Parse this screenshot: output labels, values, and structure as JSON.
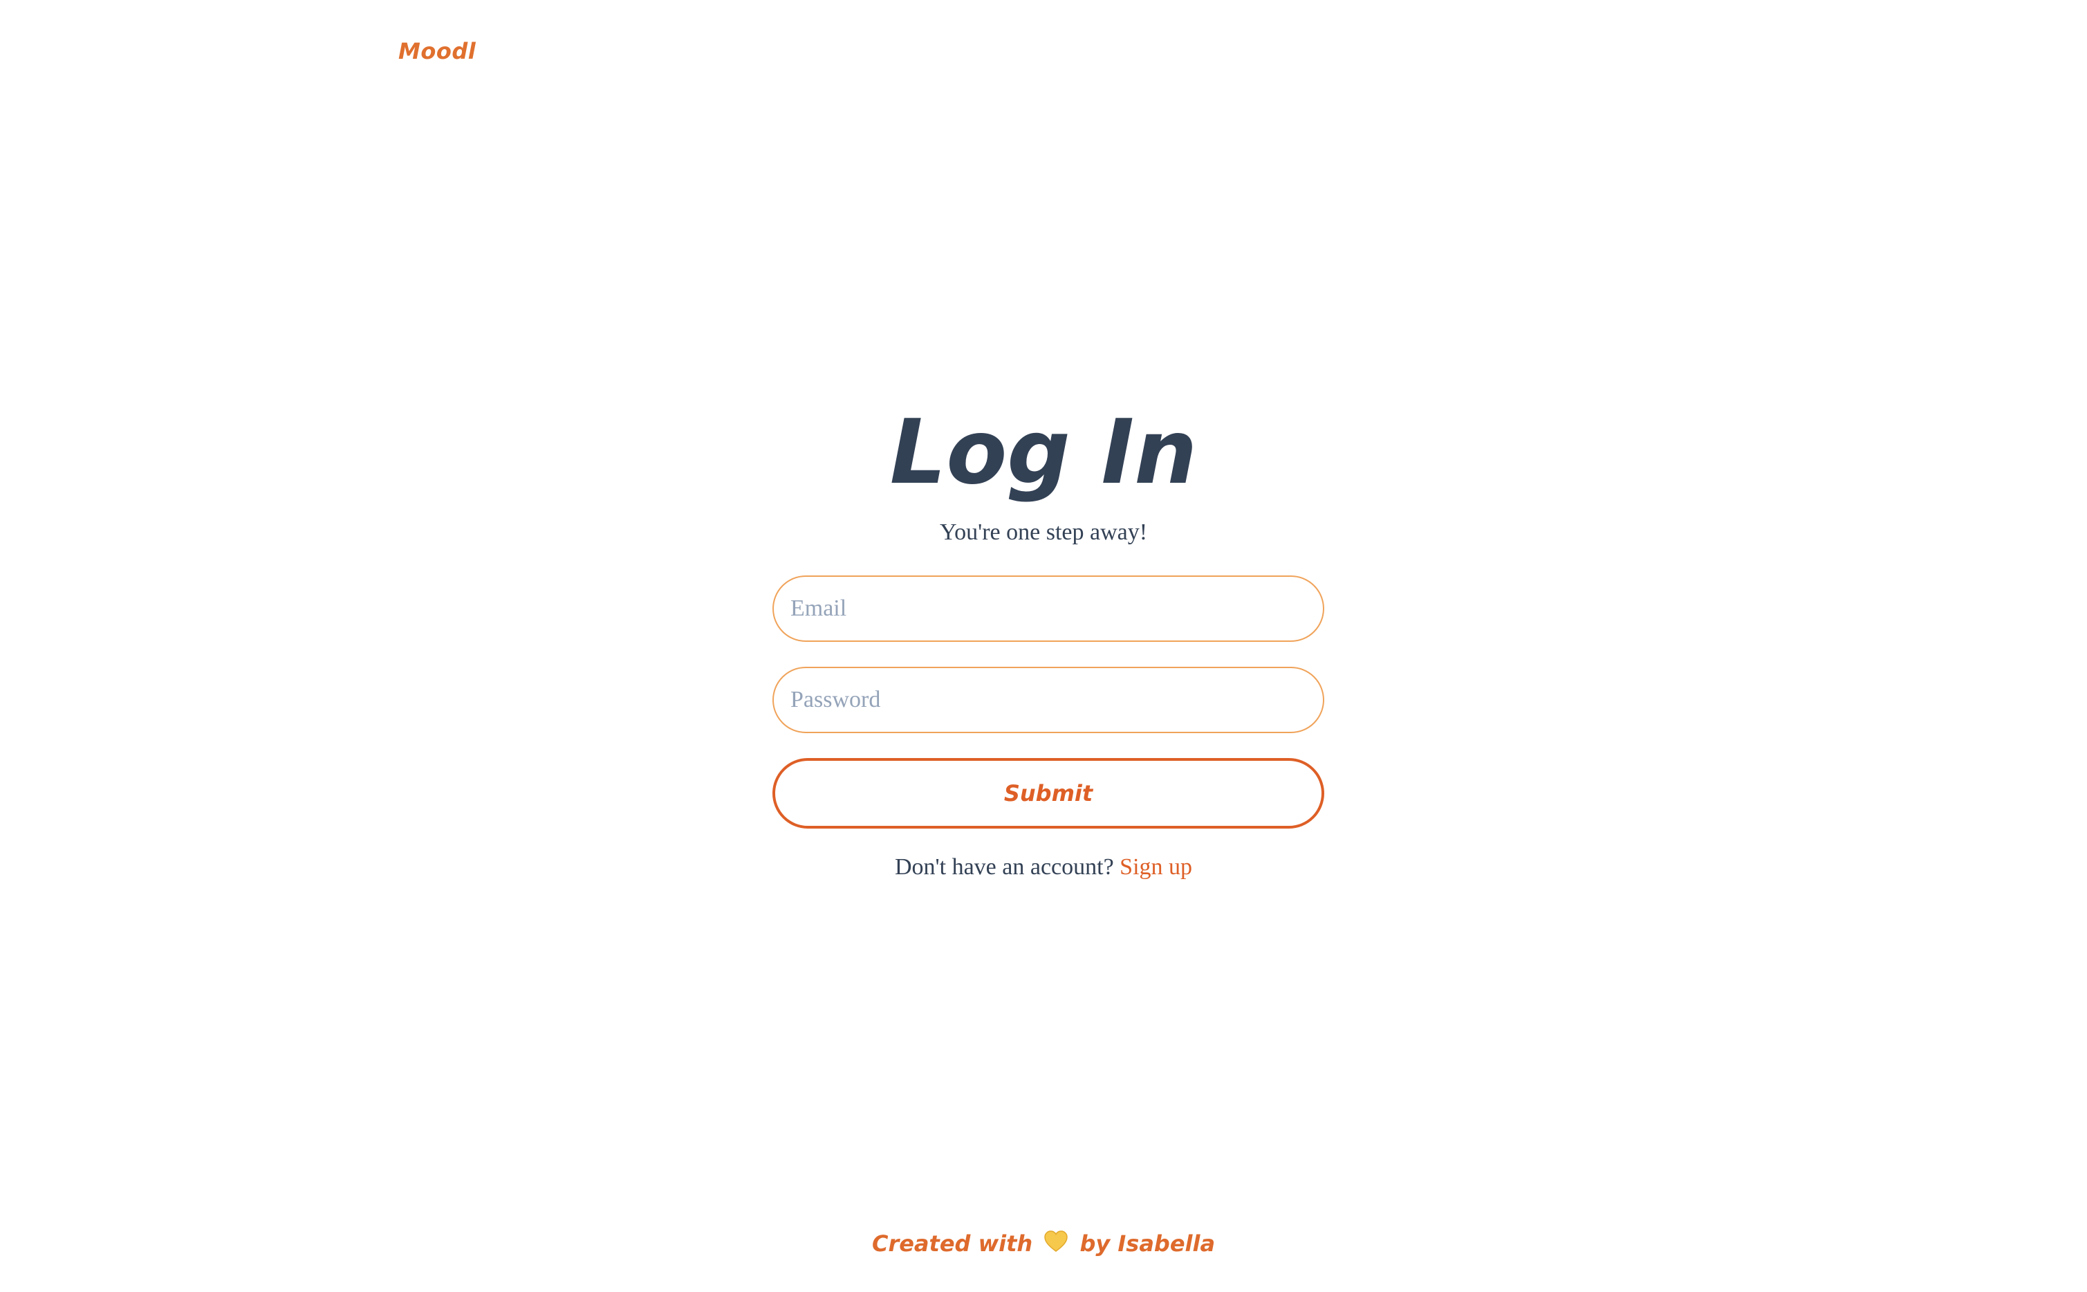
{
  "header": {
    "brand": "Moodl"
  },
  "login": {
    "title": "Log In",
    "subtitle": "You're one step away!",
    "email_placeholder": "Email",
    "password_placeholder": "Password",
    "submit_label": "Submit",
    "signup_prompt": "Don't have an account?",
    "signup_link": "Sign up"
  },
  "footer": {
    "prefix": "Created with",
    "heart_icon": "yellow-heart-icon",
    "suffix": "by Isabella"
  },
  "colors": {
    "brand": "#e0702e",
    "accent": "#de5f26",
    "field_border": "#f0a35a",
    "text": "#334155",
    "placeholder": "#94a3b8"
  }
}
